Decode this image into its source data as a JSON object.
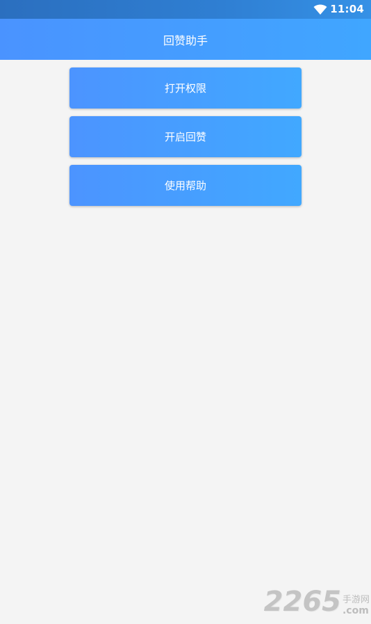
{
  "status_bar": {
    "time": "11:04",
    "wifi_icon": "wifi-icon"
  },
  "app_bar": {
    "title": "回赞助手"
  },
  "buttons": [
    {
      "label": "打开权限"
    },
    {
      "label": "开启回赞"
    },
    {
      "label": "使用帮助"
    }
  ],
  "watermark": {
    "digits": "2265",
    "cn": "手游网",
    "com": ".com"
  },
  "colors": {
    "status_bar": "#2f7fd3",
    "app_bar_start": "#4a93ff",
    "app_bar_end": "#40a6ff",
    "background": "#f4f4f4"
  }
}
